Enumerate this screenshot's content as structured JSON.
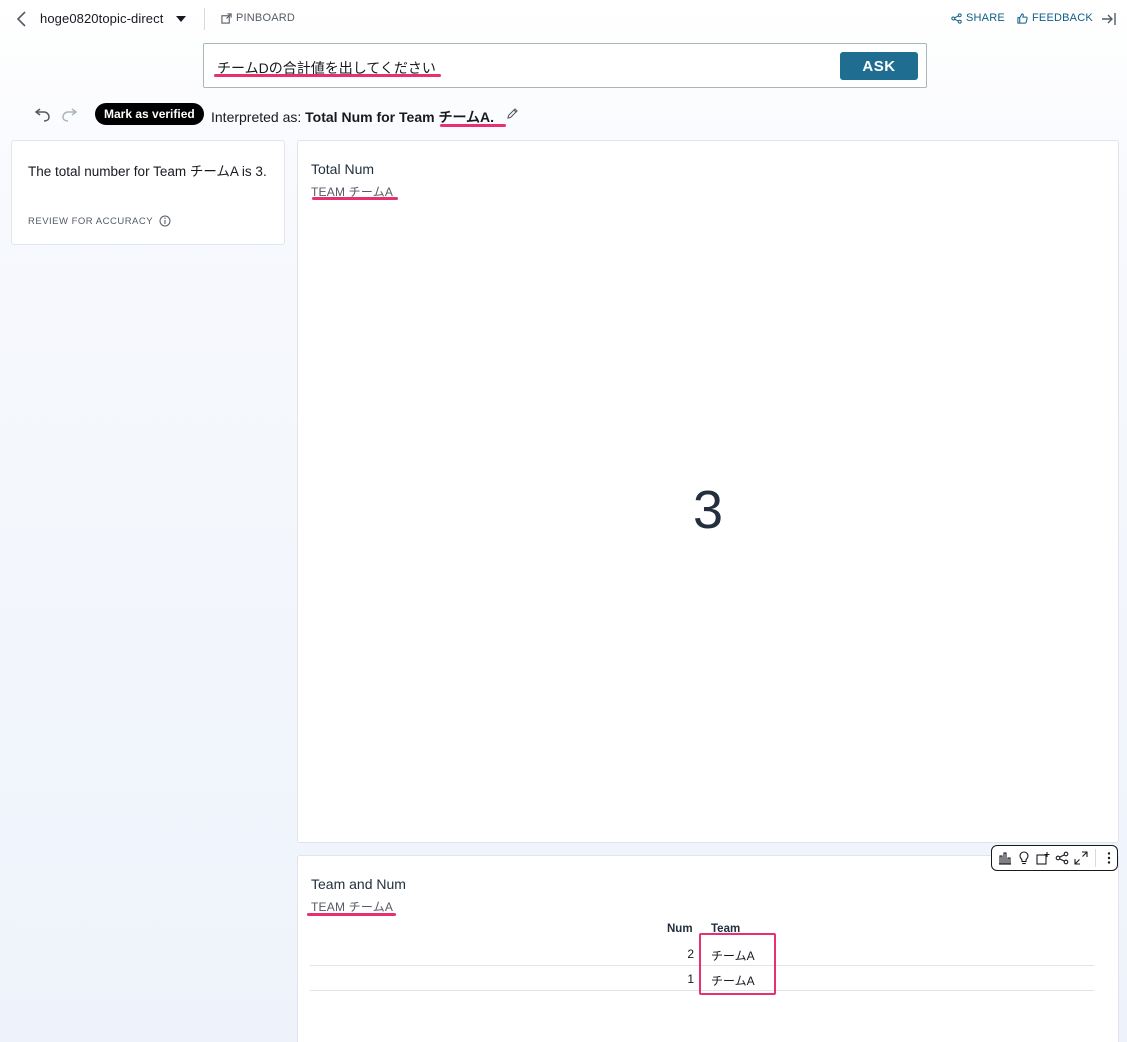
{
  "header": {
    "topic_name": "hoge0820topic-direct",
    "pinboard_label": "PINBOARD",
    "share_label": "SHARE",
    "feedback_label": "FEEDBACK"
  },
  "query": {
    "text": "チームDの合計値を出してください",
    "ask_label": "ASK"
  },
  "interpretation": {
    "verified_label": "Mark as verified",
    "prefix": "Interpreted as:",
    "main": "Total Num for Team",
    "entity": "チームA."
  },
  "summary": {
    "text": "The total number for Team チームA is 3.",
    "review_label": "REVIEW FOR ACCURACY"
  },
  "kpi_visual": {
    "title": "Total Num",
    "filter": "TEAM チームA",
    "value": "3"
  },
  "table_visual": {
    "title": "Team and Num",
    "filter": "TEAM チームA",
    "columns": [
      "Num",
      "Team"
    ],
    "rows": [
      {
        "num": "2",
        "team": "チームA"
      },
      {
        "num": "1",
        "team": "チームA"
      }
    ]
  },
  "colors": {
    "accent": "#1f6e92",
    "highlight": "#e8306e",
    "link": "#0e5e86"
  }
}
